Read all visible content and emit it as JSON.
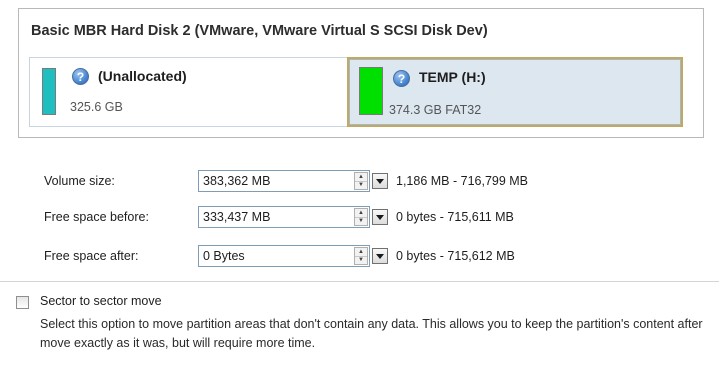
{
  "disk": {
    "title": "Basic MBR Hard Disk 2 (VMware, VMware Virtual S SCSI Disk Dev)",
    "partitions": [
      {
        "name": "(Unallocated)",
        "size": "325.6 GB",
        "color": "#1fbfbf",
        "icon": "help-icon",
        "selected": false
      },
      {
        "name": "TEMP (H:)",
        "size": "374.3 GB FAT32",
        "color": "#00e000",
        "icon": "help-icon",
        "selected": true
      }
    ]
  },
  "fields": [
    {
      "label": "Volume size:",
      "value": "383,362 MB",
      "range": "1,186 MB - 716,799 MB"
    },
    {
      "label": "Free space before:",
      "value": "333,437 MB",
      "range": "0 bytes - 715,611 MB"
    },
    {
      "label": "Free space after:",
      "value": "0 Bytes",
      "range": "0 bytes - 715,612 MB"
    }
  ],
  "sector_move": {
    "label": "Sector to sector move",
    "checked": false,
    "description": "Select this option to move partition areas that don't contain any data. This allows you to keep the partition's content after move exactly as it was, but will require more time."
  },
  "colors": {
    "selected_border": "#c5a85a",
    "selected_bg": "#dde7f0"
  }
}
